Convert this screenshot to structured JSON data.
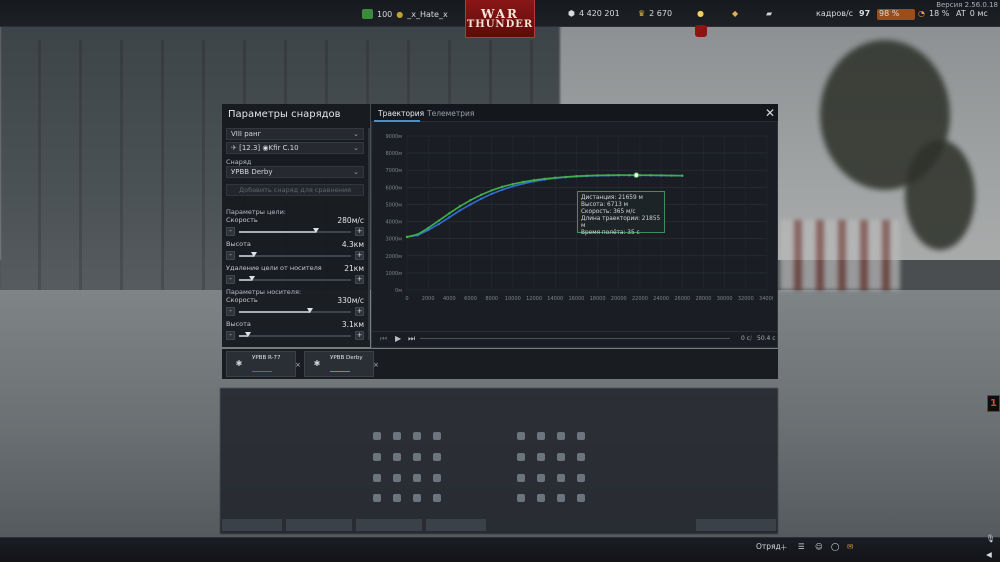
{
  "topbar": {
    "gold_value": "100",
    "username": "_x_Hate_x",
    "silver_value": "4 420 201",
    "rp_value": "2 670",
    "logo_line1": "WAR",
    "logo_line2": "THUNDER",
    "fps_label": "кадров/с",
    "fps_value": "97",
    "ping_label": "м/с",
    "load_value": "98 %",
    "pl_value": "18 %",
    "at_label": "AT",
    "ms_value": "0 мс",
    "version": "Версия 2.56.0.18"
  },
  "left_panel": {
    "title": "Параметры снарядов",
    "rank_select": "VIII ранг",
    "vehicle_select": "[12.3] ◉Kfir C.10",
    "projectile_label": "Снаряд",
    "projectile_select": "УРВВ Derby",
    "add_button": "Добавить снаряд для сравнения",
    "target_params_label": "Параметры цели:",
    "carrier_params_label": "Параметры носителя:",
    "params": [
      {
        "name": "Скорость",
        "value": "280м/с",
        "fraction": 0.69
      },
      {
        "name": "Высота",
        "value": "4.3км",
        "fraction": 0.13
      },
      {
        "name": "Удаление цели от носителя",
        "value": "21км",
        "fraction": 0.12
      },
      {
        "name": "Скорость",
        "value": "330м/с",
        "fraction": 0.63
      },
      {
        "name": "Высота",
        "value": "3.1км",
        "fraction": 0.08
      }
    ]
  },
  "chart_window": {
    "tabs": [
      {
        "label": "Траектория",
        "active": true
      },
      {
        "label": "Телеметрия",
        "active": false
      }
    ],
    "tooltip": [
      "Дистанция: 21659 м",
      "Высота: 6713 м",
      "Скорость: 365 м/с",
      "Длина траектории: 21855 м",
      "Время полёта: 35 с"
    ],
    "time_start": "0 с",
    "time_end": "50.4 с"
  },
  "chart_data": {
    "type": "line",
    "title": "",
    "xlabel": "",
    "ylabel": "",
    "xlim": [
      0,
      34000
    ],
    "ylim": [
      0,
      9000
    ],
    "x_ticks": [
      "0",
      "2000",
      "4000",
      "6000",
      "8000",
      "10000",
      "12000",
      "14000",
      "16000",
      "18000",
      "20000",
      "22000",
      "24000",
      "26000",
      "28000",
      "30000",
      "32000",
      "34000"
    ],
    "y_ticks": [
      "0м",
      "1000м",
      "2000м",
      "3000м",
      "4000м",
      "5000м",
      "6000м",
      "7000м",
      "8000м",
      "9000м"
    ],
    "grid": true,
    "series": [
      {
        "name": "УРВВ R-77",
        "color": "#2f6fd8",
        "x": [
          0,
          1000,
          2000,
          3000,
          4000,
          5000,
          6000,
          7000,
          8000,
          9000,
          10000,
          11000,
          12000,
          13000,
          14000,
          15000,
          16000,
          17000,
          18000,
          19000,
          20000,
          21000,
          22000,
          23000,
          24000,
          25000,
          26000
        ],
        "y": [
          3100,
          3200,
          3500,
          3850,
          4250,
          4650,
          5000,
          5330,
          5620,
          5860,
          6060,
          6220,
          6350,
          6450,
          6530,
          6590,
          6630,
          6660,
          6680,
          6690,
          6700,
          6705,
          6700,
          6695,
          6690,
          6685,
          6680
        ]
      },
      {
        "name": "УРВВ Derby",
        "color": "#3fb04a",
        "x": [
          0,
          1000,
          2000,
          3000,
          4000,
          5000,
          6000,
          7000,
          8000,
          9000,
          10000,
          11000,
          12000,
          13000,
          14000,
          15000,
          16000,
          17000,
          18000,
          19000,
          20000,
          21000,
          21659,
          22000,
          23000,
          24000,
          25000,
          26000
        ],
        "y": [
          3100,
          3250,
          3620,
          4050,
          4480,
          4890,
          5250,
          5560,
          5820,
          6030,
          6190,
          6320,
          6420,
          6500,
          6560,
          6610,
          6650,
          6680,
          6700,
          6710,
          6715,
          6714,
          6713,
          6712,
          6710,
          6700,
          6690,
          6680
        ]
      }
    ],
    "marker": {
      "x": 21659,
      "y": 6713
    }
  },
  "compare_cards": [
    {
      "name": "УРВВ R-77",
      "color": "#2f6fd8"
    },
    {
      "name": "УРВВ Derby",
      "color": "#3fb04a"
    }
  ],
  "bottombar": {
    "squad_label": "Отряд"
  },
  "side_badge": "1"
}
